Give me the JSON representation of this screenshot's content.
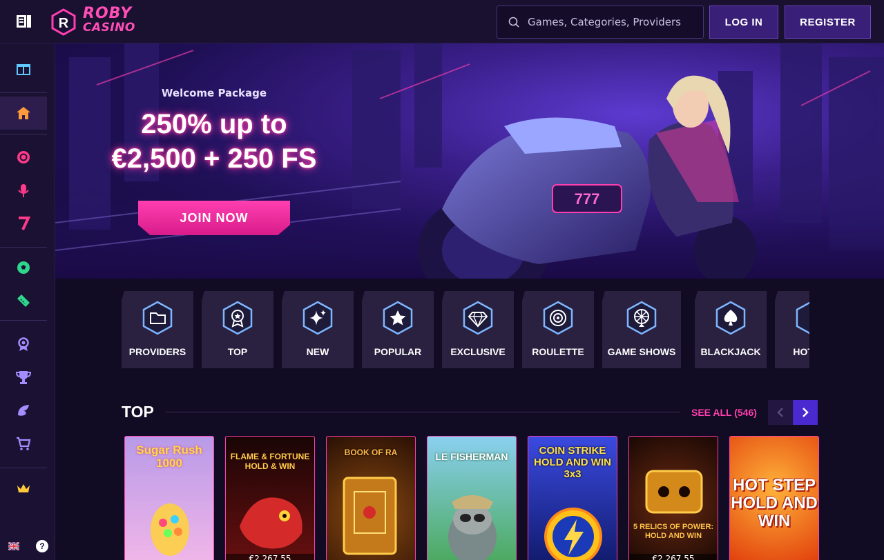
{
  "header": {
    "logo_line1": "ROBY",
    "logo_line2": "CASINO",
    "search_placeholder": "Games, Categories, Providers",
    "login_label": "LOG IN",
    "register_label": "REGISTER"
  },
  "sidebar": {
    "items": [
      {
        "icon": "gift-icon",
        "color": "#5fc9ff"
      },
      {
        "icon": "home-icon",
        "color": "#ff9b3a"
      },
      {
        "icon": "chip-icon",
        "color": "#ff3a8a"
      },
      {
        "icon": "microphone-icon",
        "color": "#ff3a8a"
      },
      {
        "icon": "seven-icon",
        "color": "#ff3a8a"
      },
      {
        "icon": "soccer-ball-icon",
        "color": "#2fd68b"
      },
      {
        "icon": "ticket-icon",
        "color": "#2fd68b"
      },
      {
        "icon": "award-icon",
        "color": "#a58cff"
      },
      {
        "icon": "trophy-icon",
        "color": "#a58cff"
      },
      {
        "icon": "boost-icon",
        "color": "#a58cff"
      },
      {
        "icon": "cart-icon",
        "color": "#a58cff"
      },
      {
        "icon": "crown-icon",
        "color": "#ffc93a"
      }
    ],
    "help_symbol": "?"
  },
  "hero": {
    "small": "Welcome Package",
    "title_line1": "250% up to",
    "title_line2": "€2,500 + 250 FS",
    "join_label": "JOIN NOW",
    "bike_plate": "777"
  },
  "categories": [
    {
      "label": "PROVIDERS",
      "icon": "folder-icon"
    },
    {
      "label": "TOP",
      "icon": "medal-icon"
    },
    {
      "label": "NEW",
      "icon": "sparkle-icon"
    },
    {
      "label": "POPULAR",
      "icon": "star-icon"
    },
    {
      "label": "EXCLUSIVE",
      "icon": "diamond-icon"
    },
    {
      "label": "ROULETTE",
      "icon": "roulette-icon"
    },
    {
      "label": "GAME SHOWS",
      "icon": "wheel-icon"
    },
    {
      "label": "BLACKJACK",
      "icon": "spade-icon"
    },
    {
      "label": "HOT JA",
      "icon": "hot-icon"
    }
  ],
  "top": {
    "title": "TOP",
    "see_all": "SEE ALL (546)"
  },
  "games": [
    {
      "title": "Sugar Rush 1000",
      "bg": "#e9a7e6",
      "title_color": "#ffd84a",
      "price": ""
    },
    {
      "title": "FLAME & FORTUNE HOLD & WIN",
      "bg": "#3a0d0d",
      "title_color": "#ffcc4a",
      "price": "€2,267.55"
    },
    {
      "title": "BOOK OF RA",
      "bg": "#3a1a08",
      "title_color": "#ffb84a",
      "price": ""
    },
    {
      "title": "LE FISHERMAN",
      "bg": "#5fb86a",
      "title_color": "#ffffff",
      "price": ""
    },
    {
      "title": "COIN STRIKE HOLD AND WIN 3x3",
      "bg": "#1e3bb8",
      "title_color": "#ffe04a",
      "price": ""
    },
    {
      "title": "5 RELICS OF POWER: HOLD AND WIN",
      "bg": "#3a1408",
      "title_color": "#ffc24a",
      "price": "€2,267.55"
    },
    {
      "title": "HOT STEP HOLD AND WIN",
      "bg": "#ff6a1a",
      "title_color": "#ffffff",
      "price": ""
    }
  ]
}
